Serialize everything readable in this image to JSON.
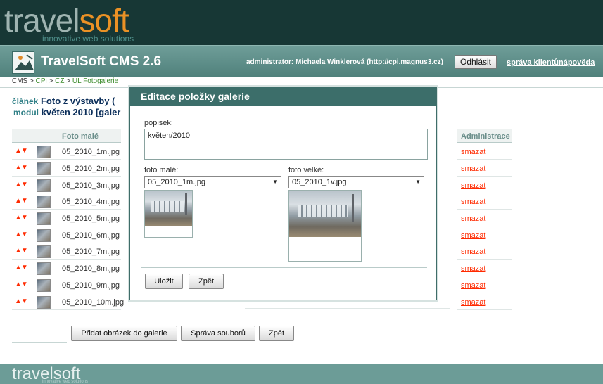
{
  "branding": {
    "logo_part1": "travel",
    "logo_part2": "soft",
    "tagline": "innovative web solutions"
  },
  "header": {
    "title": "TravelSoft CMS 2.6",
    "user_info": "administrator: Michaela Winklerová (http://cpi.magnus3.cz)",
    "logout_label": "Odhlásit",
    "client_admin_link": "správa klientů",
    "help_link": "nápověda"
  },
  "breadcrumb": {
    "root": "CMS",
    "sep": " > ",
    "items": [
      "CPi",
      "CZ",
      "UL Fotogalerie"
    ]
  },
  "context": {
    "article_label": "článek",
    "article_value": "Foto z výstavby (",
    "module_label": "modul",
    "module_value": "květen 2010 [galer"
  },
  "table": {
    "col_small_photo": "Foto malé",
    "col_admin": "Administrace",
    "move_arrows": "▲▼",
    "delete_label": "smazat",
    "rows": [
      {
        "file": "05_2010_1m.jpg"
      },
      {
        "file": "05_2010_2m.jpg"
      },
      {
        "file": "05_2010_3m.jpg"
      },
      {
        "file": "05_2010_4m.jpg"
      },
      {
        "file": "05_2010_5m.jpg"
      },
      {
        "file": "05_2010_6m.jpg"
      },
      {
        "file": "05_2010_7m.jpg"
      },
      {
        "file": "05_2010_8m.jpg"
      },
      {
        "file": "05_2010_9m.jpg"
      },
      {
        "file": "05_2010_10m.jpg"
      }
    ]
  },
  "actions": {
    "add_image": "Přidat obrázek do galerie",
    "manage_files": "Správa souborů",
    "back": "Zpět"
  },
  "modal": {
    "title": "Editace položky galerie",
    "description_label": "popisek:",
    "description_value": "květen/2010",
    "small_photo_label": "foto malé:",
    "small_photo_value": "05_2010_1m.jpg",
    "large_photo_label": "foto velké:",
    "large_photo_value": "05_2010_1v.jpg",
    "save_label": "Uložit",
    "back_label": "Zpět"
  },
  "footer": {
    "logo": "travelsoft",
    "tagline": "innovative web solutions"
  },
  "colors": {
    "top_band": "#173735",
    "header_bar": "#5f8f8a",
    "logo_accent": "#ea9125",
    "link_red": "#ff2a00",
    "modal_title_bg": "#3c6e6a"
  }
}
